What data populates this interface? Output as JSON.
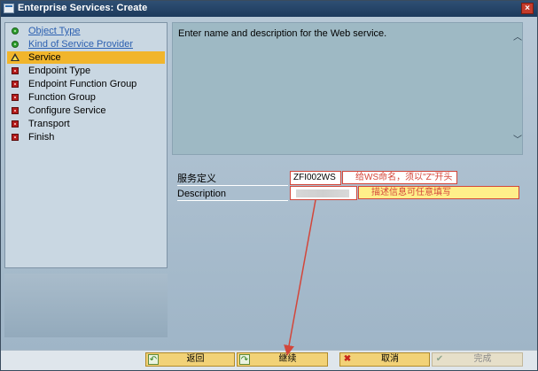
{
  "window": {
    "title": "Enterprise Services: Create",
    "close_glyph": "×"
  },
  "steps": [
    {
      "label": "Object Type",
      "status": "done",
      "link": true
    },
    {
      "label": "Kind of Service Provider",
      "status": "done",
      "link": true
    },
    {
      "label": "Service",
      "status": "current",
      "link": false
    },
    {
      "label": "Endpoint Type",
      "status": "pending",
      "link": false
    },
    {
      "label": "Endpoint Function Group",
      "status": "pending",
      "link": false
    },
    {
      "label": "Function Group",
      "status": "pending",
      "link": false
    },
    {
      "label": "Configure Service",
      "status": "pending",
      "link": false
    },
    {
      "label": "Transport",
      "status": "pending",
      "link": false
    },
    {
      "label": "Finish",
      "status": "pending",
      "link": false
    }
  ],
  "info": {
    "text": "Enter name and description for the Web service."
  },
  "form": {
    "service_label": "服务定义",
    "service_value": "ZFI002WS",
    "description_label": "Description",
    "description_value": ""
  },
  "annotations": {
    "name_note": "给WS命名，须以\"Z\"开头",
    "desc_note": "描述信息可任意填写"
  },
  "buttons": {
    "back": "返回",
    "continue": "继续",
    "cancel": "取消",
    "complete": "完成"
  },
  "icons": {
    "back": "↶",
    "continue": "↷",
    "cancel": "✖",
    "complete": "✔"
  },
  "colors": {
    "accent_current_step": "#f1b52b",
    "annotation_red": "#d3463a",
    "button_yellow": "#f2d277",
    "title_bar": "#1d3a5c"
  }
}
